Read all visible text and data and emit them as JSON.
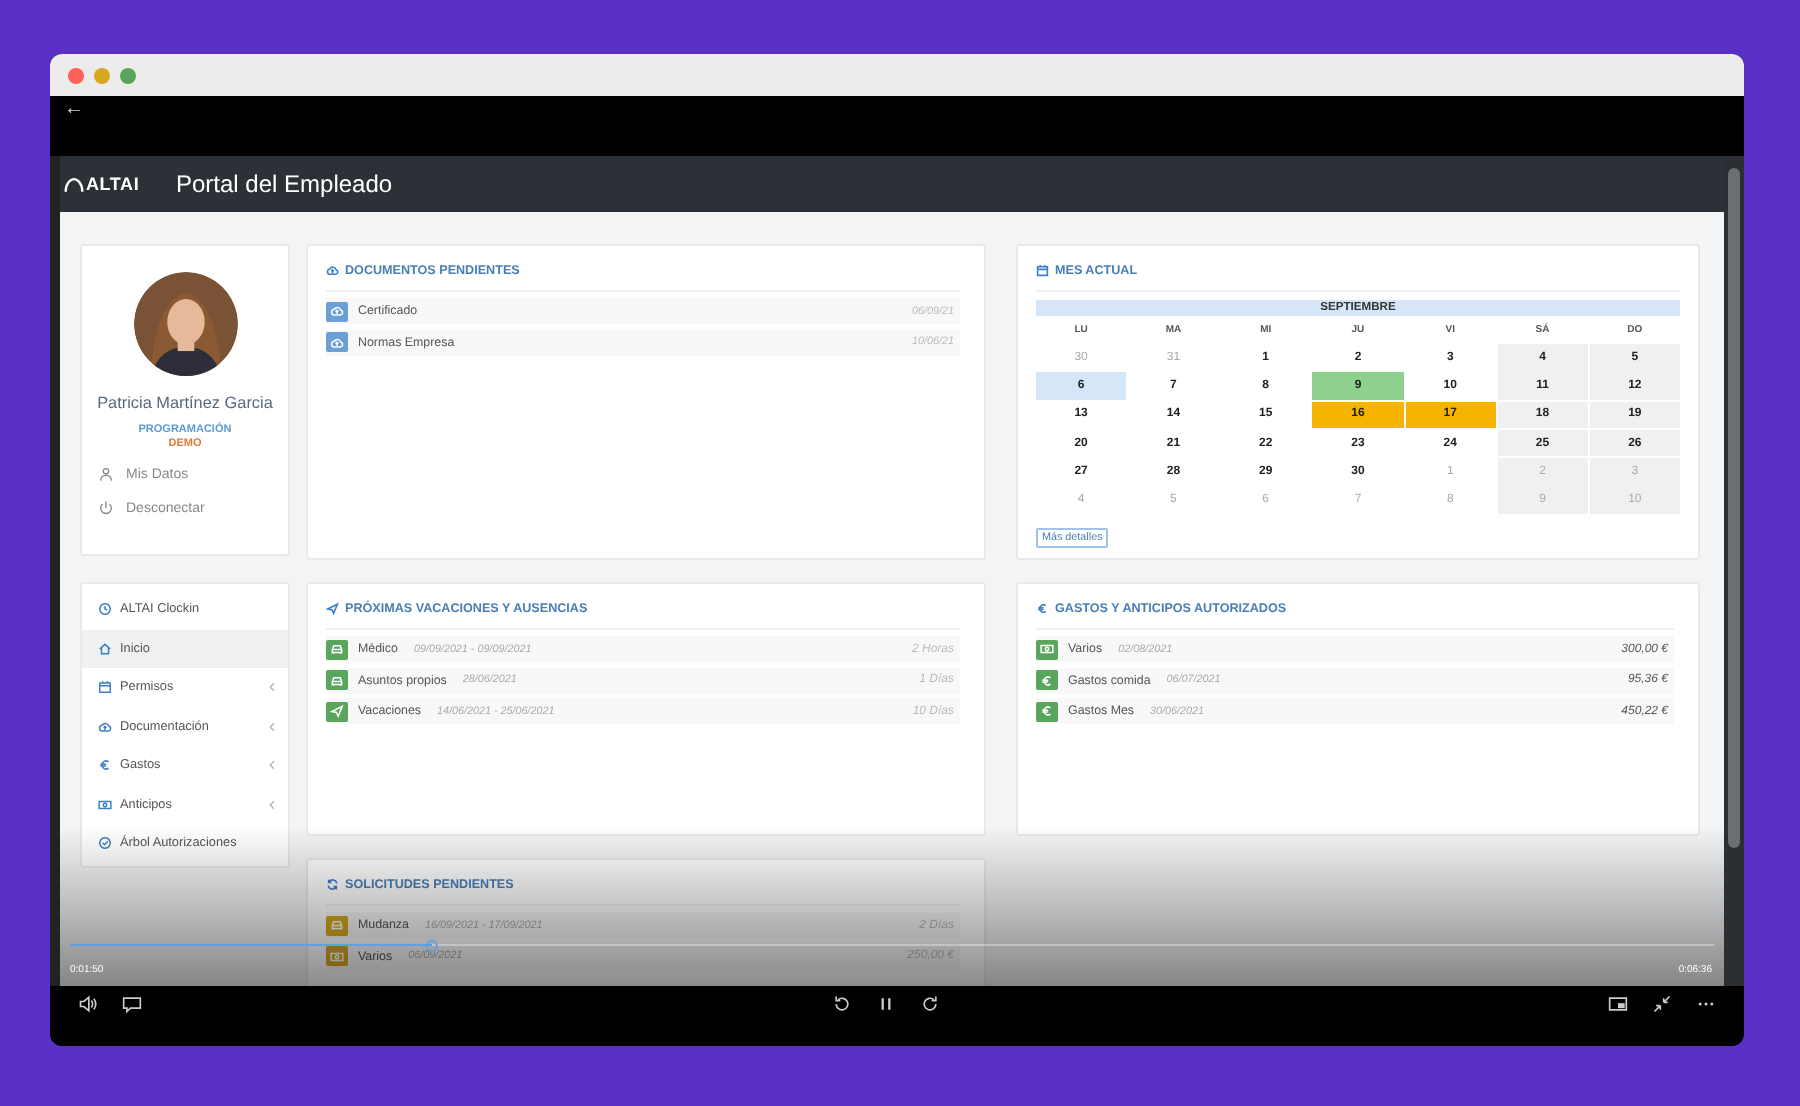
{
  "browser": {
    "back": "←"
  },
  "app": {
    "logo": "ALTAI",
    "title": "Portal del Empleado"
  },
  "profile": {
    "name": "Patricia Martínez Garcia",
    "department": "PROGRAMACIÓN",
    "company": "DEMO",
    "links": [
      {
        "label": "Mis Datos",
        "kind": "user"
      },
      {
        "label": "Desconectar",
        "kind": "power"
      }
    ]
  },
  "menu": [
    {
      "label": "ALTAI Clockin",
      "kind": "clock",
      "selected": false,
      "submenu": false
    },
    {
      "label": "Inicio",
      "kind": "home",
      "selected": true,
      "submenu": false
    },
    {
      "label": "Permisos",
      "kind": "calendar",
      "selected": false,
      "submenu": true
    },
    {
      "label": "Documentación",
      "kind": "cloud",
      "selected": false,
      "submenu": true
    },
    {
      "label": "Gastos",
      "kind": "euro",
      "selected": false,
      "submenu": true
    },
    {
      "label": "Anticipos",
      "kind": "money",
      "selected": false,
      "submenu": true
    },
    {
      "label": "Árbol Autorizaciones",
      "kind": "check",
      "selected": false,
      "submenu": false
    }
  ],
  "documents": {
    "title": "DOCUMENTOS PENDIENTES",
    "rows": [
      {
        "kind": "cloud",
        "name": "Certificado",
        "date": "06/09/21"
      },
      {
        "kind": "cloud",
        "name": "Normas Empresa",
        "date": "10/06/21"
      }
    ]
  },
  "calendar": {
    "title": "MES ACTUAL",
    "month": "SEPTIEMBRE",
    "weekdays": [
      "LU",
      "MA",
      "MI",
      "JU",
      "VI",
      "SÁ",
      "DO"
    ],
    "weeks": [
      [
        {
          "day": "30",
          "kind": "other"
        },
        {
          "day": "31",
          "kind": "other"
        },
        {
          "day": "1",
          "kind": "normal"
        },
        {
          "day": "2",
          "kind": "normal"
        },
        {
          "day": "3",
          "kind": "normal"
        },
        {
          "day": "4",
          "kind": "normal"
        },
        {
          "day": "5",
          "kind": "normal"
        }
      ],
      [
        {
          "day": "6",
          "kind": "today"
        },
        {
          "day": "7",
          "kind": "normal"
        },
        {
          "day": "8",
          "kind": "normal"
        },
        {
          "day": "9",
          "kind": "approved"
        },
        {
          "day": "10",
          "kind": "normal"
        },
        {
          "day": "11",
          "kind": "normal"
        },
        {
          "day": "12",
          "kind": "normal"
        }
      ],
      [
        {
          "day": "13",
          "kind": "normal"
        },
        {
          "day": "14",
          "kind": "normal"
        },
        {
          "day": "15",
          "kind": "normal"
        },
        {
          "day": "16",
          "kind": "pending"
        },
        {
          "day": "17",
          "kind": "pending"
        },
        {
          "day": "18",
          "kind": "normal"
        },
        {
          "day": "19",
          "kind": "normal"
        }
      ],
      [
        {
          "day": "20",
          "kind": "normal"
        },
        {
          "day": "21",
          "kind": "normal"
        },
        {
          "day": "22",
          "kind": "normal"
        },
        {
          "day": "23",
          "kind": "normal"
        },
        {
          "day": "24",
          "kind": "normal"
        },
        {
          "day": "25",
          "kind": "normal"
        },
        {
          "day": "26",
          "kind": "normal"
        }
      ],
      [
        {
          "day": "27",
          "kind": "normal"
        },
        {
          "day": "28",
          "kind": "normal"
        },
        {
          "day": "29",
          "kind": "normal"
        },
        {
          "day": "30",
          "kind": "normal"
        },
        {
          "day": "1",
          "kind": "other"
        },
        {
          "day": "2",
          "kind": "other"
        },
        {
          "day": "3",
          "kind": "other"
        }
      ],
      [
        {
          "day": "4",
          "kind": "other"
        },
        {
          "day": "5",
          "kind": "other"
        },
        {
          "day": "6",
          "kind": "other"
        },
        {
          "day": "7",
          "kind": "other"
        },
        {
          "day": "8",
          "kind": "other"
        },
        {
          "day": "9",
          "kind": "other"
        },
        {
          "day": "10",
          "kind": "other"
        }
      ]
    ],
    "details_button": "Más detalles"
  },
  "vacations": {
    "title": "PRÓXIMAS VACACIONES Y AUSENCIAS",
    "rows": [
      {
        "kind": "car",
        "name": "Médico",
        "date": "09/09/2021 - 09/09/2021",
        "amount": "2 Horas"
      },
      {
        "kind": "car",
        "name": "Asuntos propios",
        "date": "28/06/2021",
        "amount": "1 Días"
      },
      {
        "kind": "plane",
        "name": "Vacaciones",
        "date": "14/06/2021 - 25/06/2021",
        "amount": "10 Días"
      }
    ]
  },
  "expenses": {
    "title": "GASTOS Y ANTICIPOS AUTORIZADOS",
    "rows": [
      {
        "kind": "money",
        "name": "Varios",
        "date": "02/08/2021",
        "amount": "300,00 €"
      },
      {
        "kind": "euro",
        "name": "Gastos comida",
        "date": "06/07/2021",
        "amount": "95,36 €"
      },
      {
        "kind": "euro",
        "name": "Gastos Mes",
        "date": "30/06/2021",
        "amount": "450,22 €"
      }
    ]
  },
  "requests": {
    "title": "SOLICITUDES PENDIENTES",
    "rows": [
      {
        "kind": "car",
        "name": "Mudanza",
        "date": "16/09/2021 - 17/09/2021",
        "amount": "2 Días"
      },
      {
        "kind": "money",
        "name": "Varios",
        "date": "06/09/2021",
        "amount": "250,00 €"
      }
    ]
  },
  "player": {
    "elapsed": "0:01:50",
    "duration": "0:06:36",
    "level": 0.22,
    "playing": true
  }
}
